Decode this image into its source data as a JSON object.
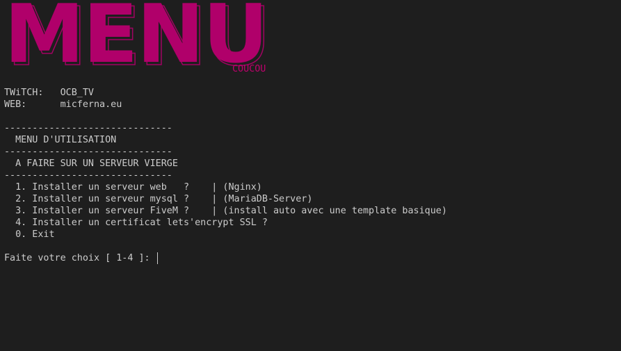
{
  "banner": {
    "title": "MENU",
    "subtitle": "COUCOU"
  },
  "info": {
    "twitch_label": "TWiTCH:",
    "twitch_value": "OCB_TV",
    "web_label": "WEB:",
    "web_value": "micferna.eu"
  },
  "menu": {
    "separator": "------------------------------",
    "title": "  MENU D'UTILISATION",
    "subtitle": "  A FAIRE SUR UN SERVEUR VIERGE",
    "options": [
      "  1. Installer un serveur web   ?    | (Nginx)",
      "  2. Installer un serveur mysql ?    | (MariaDB-Server)",
      "  3. Installer un serveur FiveM ?    | (install auto avec une template basique)",
      "  4. Installer un certificat lets'encrypt SSL ?",
      "  0. Exit"
    ]
  },
  "prompt": {
    "text": "Faite votre choix [ 1-4 ]: ",
    "value": ""
  },
  "colors": {
    "background": "#1e1e1e",
    "text": "#cccccc",
    "accent": "#b0006a"
  }
}
